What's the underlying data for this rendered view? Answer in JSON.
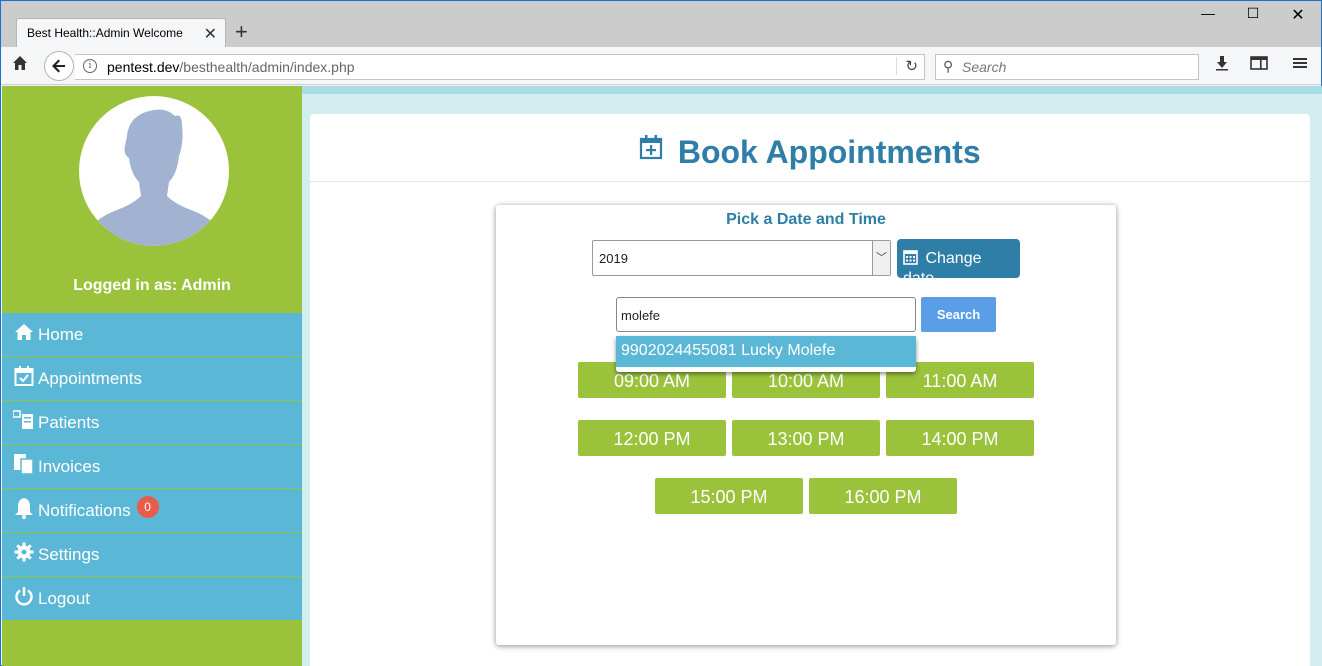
{
  "browser": {
    "tab_title": "Best Health::Admin Welcome",
    "url_domain": "pentest.dev",
    "url_path": "/besthealth/admin/index.php",
    "search_placeholder": "Search"
  },
  "sidebar": {
    "logged_in_text": "Logged in as: Admin",
    "items": [
      {
        "label": "Home",
        "icon": "home-icon"
      },
      {
        "label": "Appointments",
        "icon": "calendar-check-icon"
      },
      {
        "label": "Patients",
        "icon": "patients-icon"
      },
      {
        "label": "Invoices",
        "icon": "invoices-icon"
      },
      {
        "label": "Notifications",
        "icon": "bell-icon",
        "badge": "0"
      },
      {
        "label": "Settings",
        "icon": "gear-icon"
      },
      {
        "label": "Logout",
        "icon": "power-icon"
      }
    ]
  },
  "main": {
    "title": "Book Appointments",
    "card_title": "Pick a Date and Time",
    "year_value": "2019",
    "change_date_label": "Change date",
    "search_value": "molefe",
    "search_button": "Search",
    "suggestion": "9902024455081 Lucky Molefe",
    "time_slots": [
      "09:00 AM",
      "10:00 AM",
      "11:00 AM",
      "12:00 PM",
      "13:00 PM",
      "14:00 PM",
      "15:00 PM",
      "16:00 PM"
    ]
  },
  "colors": {
    "sidebar_green": "#9ac33b",
    "menu_blue": "#5bb7d6",
    "title_blue": "#2e7ea8",
    "badge_red": "#e95b4b",
    "search_button_blue": "#5a9ee8"
  }
}
